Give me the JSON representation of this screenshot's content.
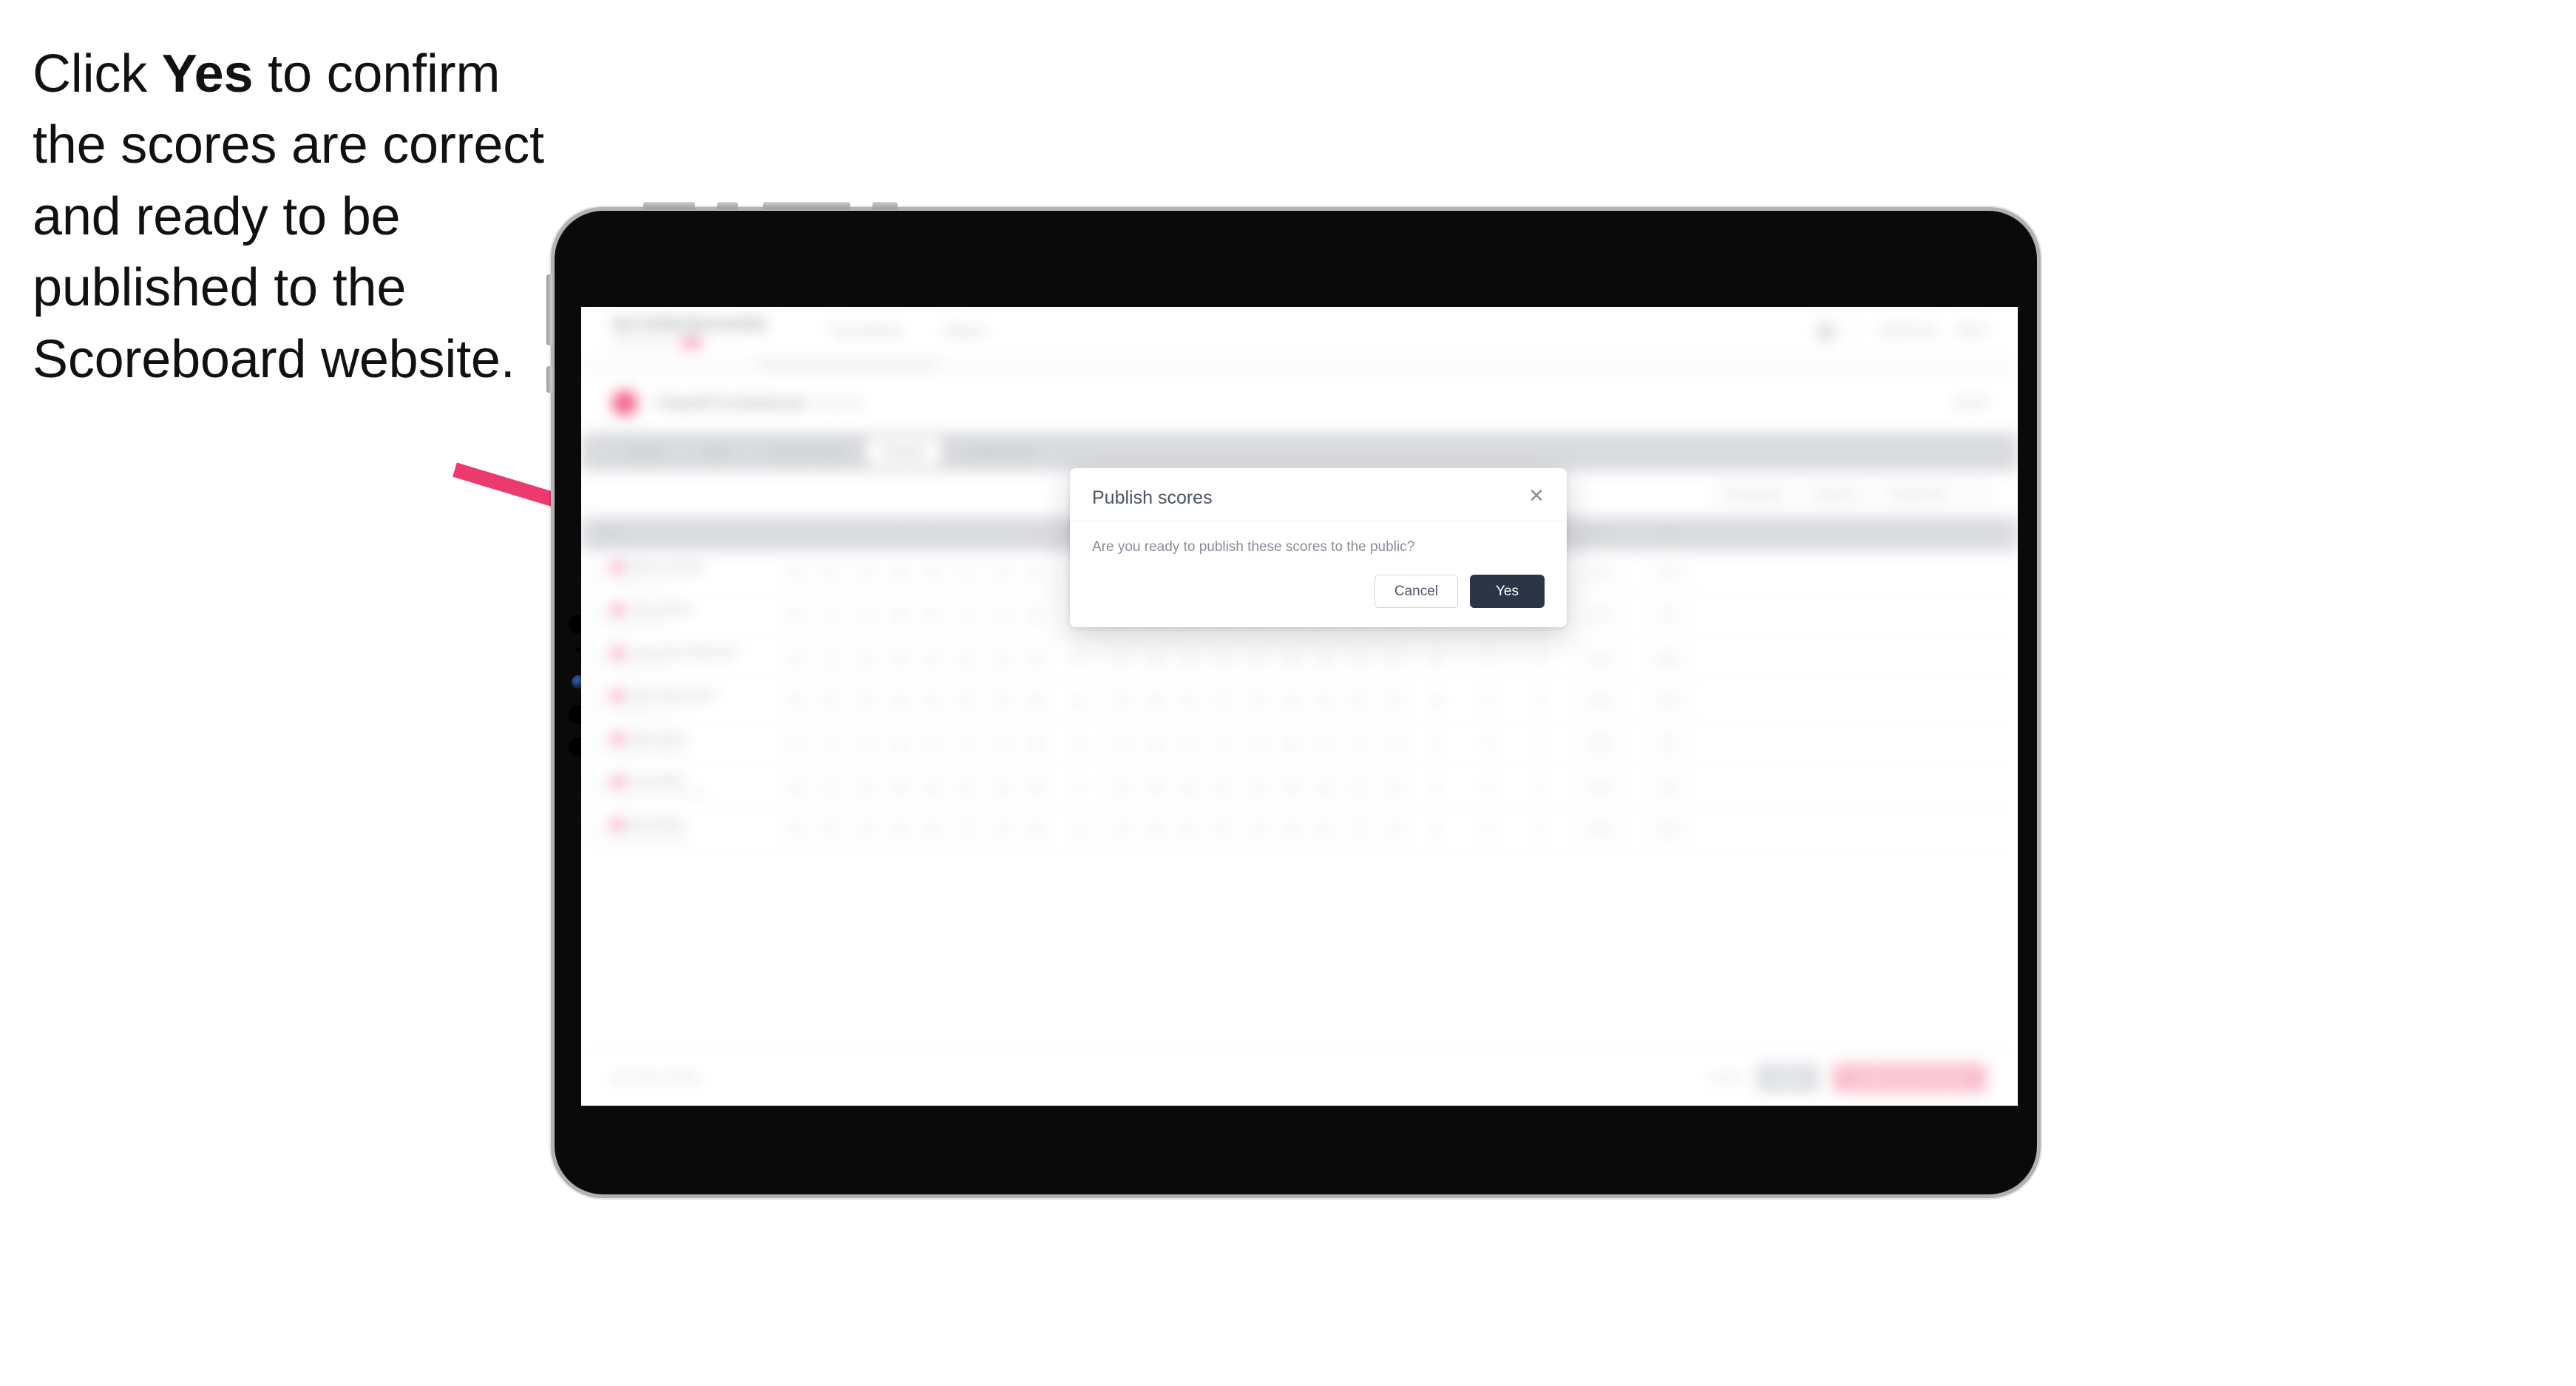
{
  "caption": {
    "line1_pre": "Click ",
    "bold": "Yes",
    "line1_post": " to confirm the scores are correct and ready to be published to the Scoreboard website."
  },
  "annotation": {
    "arrow_color": "#ec3a6e",
    "arrow_name": "pointer-arrow"
  },
  "device": {
    "type": "tablet",
    "bezel_color": "#0a0a0a",
    "rim_color": "#b2b2b2"
  },
  "app": {
    "brand": "SCOREBOARD",
    "brand_sub": "POWERED BY",
    "nav_links": [
      "Tournaments",
      "Players"
    ],
    "nav_right": [
      "Add Event",
      "Menu"
    ],
    "event": {
      "title": "Clayhill Invitational",
      "subtitle": "Round 1",
      "meta": "Detail"
    },
    "tabs": [
      {
        "label": "Details",
        "active": false
      },
      {
        "label": "Tees",
        "active": false
      },
      {
        "label": "Course Setup",
        "active": false
      },
      {
        "label": "Results",
        "active": true
      },
      {
        "label": "Leaderboard",
        "active": false
      }
    ],
    "filters": {
      "chip1": "All Divisions",
      "chip2": "Round 1",
      "chip3": "Stroke Play",
      "icon": "filter-icon"
    },
    "table": {
      "columns": [
        "Player",
        "1",
        "2",
        "3",
        "4",
        "5",
        "6",
        "7",
        "8",
        "OUT",
        "10",
        "11",
        "12",
        "13",
        "14",
        "15",
        "16",
        "17",
        "18",
        "IN",
        "Total",
        "Par",
        "Gross",
        "Net"
      ],
      "rows": [
        {
          "name": "Marcus Temple",
          "club": "Clayhill Golf Club",
          "scores": [
            "4",
            "5",
            "3",
            "4",
            "5",
            "4",
            "3",
            "4",
            "36",
            "4",
            "5",
            "3",
            "4",
            "4",
            "5",
            "4",
            "3",
            "4",
            "36",
            "72",
            "E"
          ],
          "gross": "72",
          "net": "70"
        },
        {
          "name": "Theo Parnell",
          "club": "Bramley Heath",
          "scores": [
            "5",
            "4",
            "4",
            "3",
            "5",
            "4",
            "4",
            "4",
            "37",
            "4",
            "4",
            "4",
            "5",
            "3",
            "5",
            "4",
            "4",
            "4",
            "37",
            "74",
            "+2"
          ],
          "gross": "74",
          "net": "71"
        },
        {
          "name": "Cassandra Robertson",
          "club": "Windmere Park",
          "scores": [
            "4",
            "4",
            "3",
            "5",
            "4",
            "5",
            "3",
            "4",
            "36",
            "5",
            "4",
            "3",
            "4",
            "4",
            "4",
            "5",
            "4",
            "3",
            "36",
            "72",
            "E"
          ],
          "gross": "72",
          "net": "69"
        },
        {
          "name": "Olive Rasmussen",
          "club": "Harrowdown Links",
          "scores": [
            "5",
            "5",
            "4",
            "4",
            "4",
            "3",
            "4",
            "5",
            "38",
            "4",
            "5",
            "4",
            "4",
            "5",
            "4",
            "4",
            "3",
            "5",
            "38",
            "76",
            "+4"
          ],
          "gross": "76",
          "net": "72"
        },
        {
          "name": "Dylan Quist",
          "club": "Southbank Fairways",
          "scores": [
            "4",
            "4",
            "4",
            "4",
            "5",
            "4",
            "3",
            "4",
            "36",
            "4",
            "4",
            "5",
            "4",
            "4",
            "3",
            "5",
            "4",
            "4",
            "37",
            "73",
            "+1"
          ],
          "gross": "73",
          "net": "70"
        },
        {
          "name": "Nova Whitt",
          "club": "Ravensmoor Country Club",
          "scores": [
            "5",
            "4",
            "3",
            "4",
            "4",
            "5",
            "4",
            "4",
            "37",
            "5",
            "4",
            "4",
            "3",
            "5",
            "4",
            "4",
            "4",
            "4",
            "37",
            "74",
            "+2"
          ],
          "gross": "74",
          "net": "71"
        },
        {
          "name": "Bell Abbott",
          "club": "Greyhollow Fairways",
          "scores": [
            "4",
            "5",
            "4",
            "3",
            "5",
            "4",
            "4",
            "5",
            "38",
            "4",
            "4",
            "3",
            "5",
            "4",
            "5",
            "4",
            "4",
            "4",
            "37",
            "75",
            "+3"
          ],
          "gross": "75",
          "net": "72"
        }
      ]
    },
    "actionbar": {
      "note": "All scores verified",
      "link": "Cancel",
      "secondary": "Save",
      "primary": "Publish to Scoreboard"
    }
  },
  "modal": {
    "title": "Publish scores",
    "body": "Are you ready to publish these scores to the public?",
    "close_icon": "close-icon",
    "cancel_label": "Cancel",
    "confirm_label": "Yes",
    "confirm_bg": "#2b3545"
  }
}
